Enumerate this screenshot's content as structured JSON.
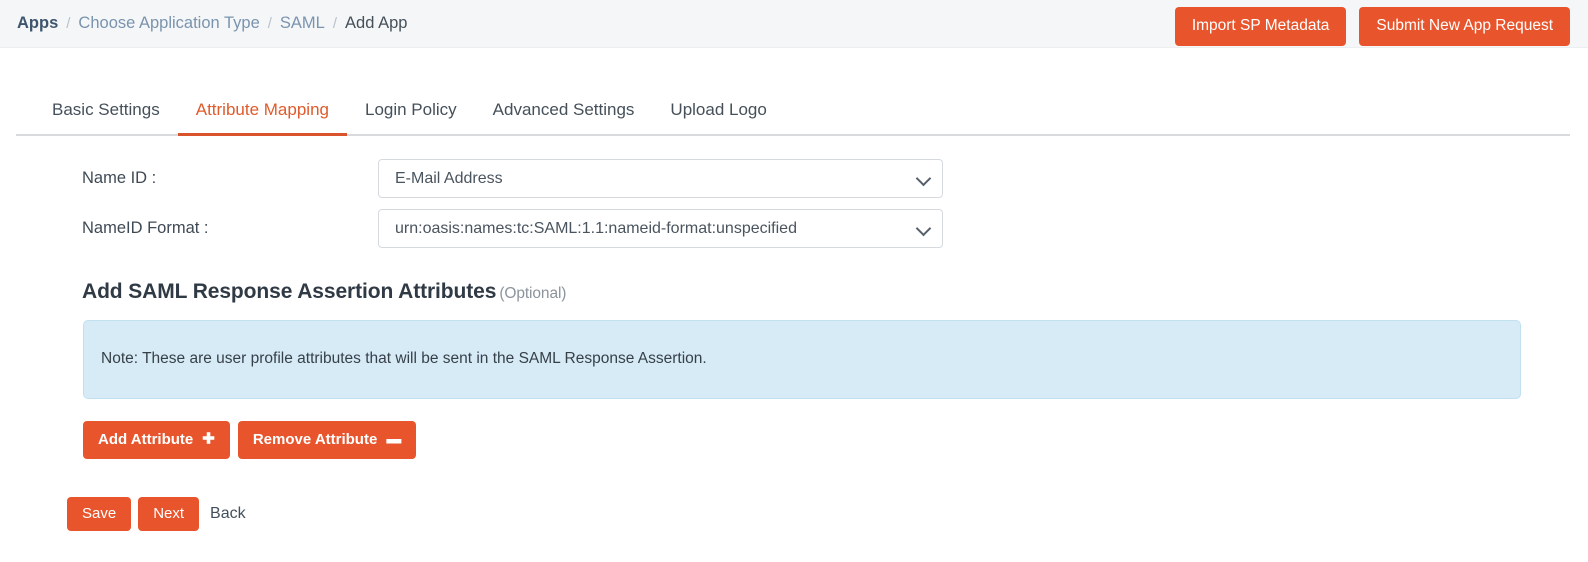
{
  "topbar": {
    "breadcrumb": [
      {
        "label": "Apps",
        "current": false
      },
      {
        "label": "Choose Application Type",
        "current": false
      },
      {
        "label": "SAML",
        "current": false
      },
      {
        "label": "Add App",
        "current": true
      }
    ],
    "separator": "/",
    "actions": {
      "import_sp_metadata": "Import SP Metadata",
      "submit_new_app_request": "Submit New App Request"
    }
  },
  "tabs": [
    {
      "label": "Basic Settings",
      "active": false
    },
    {
      "label": "Attribute Mapping",
      "active": true
    },
    {
      "label": "Login Policy",
      "active": false
    },
    {
      "label": "Advanced Settings",
      "active": false
    },
    {
      "label": "Upload Logo",
      "active": false
    }
  ],
  "form": {
    "name_id": {
      "label": "Name ID :",
      "value": "E-Mail Address",
      "options": [
        "E-Mail Address"
      ]
    },
    "nameid_format": {
      "label": "NameID Format :",
      "value": "urn:oasis:names:tc:SAML:1.1:nameid-format:unspecified",
      "options": [
        "urn:oasis:names:tc:SAML:1.1:nameid-format:unspecified"
      ]
    }
  },
  "section": {
    "heading": "Add SAML Response Assertion Attributes",
    "optional": "(Optional)",
    "note": "Note: These are user profile attributes that will be sent in the SAML Response Assertion."
  },
  "attribute_actions": {
    "add_label": "Add Attribute",
    "add_icon": "plus-icon",
    "add_glyph": "✚",
    "remove_label": "Remove Attribute",
    "remove_icon": "minus-icon",
    "remove_glyph": "▬"
  },
  "footer": {
    "save": "Save",
    "next": "Next",
    "back": "Back"
  },
  "colors": {
    "accent": "#e8552c",
    "tab_active": "#e05a2b",
    "note_bg": "#d6ebf6",
    "note_border": "#c2e1f0",
    "topbar_bg": "#f5f6f8",
    "breadcrumb_link": "#7a94ad"
  }
}
